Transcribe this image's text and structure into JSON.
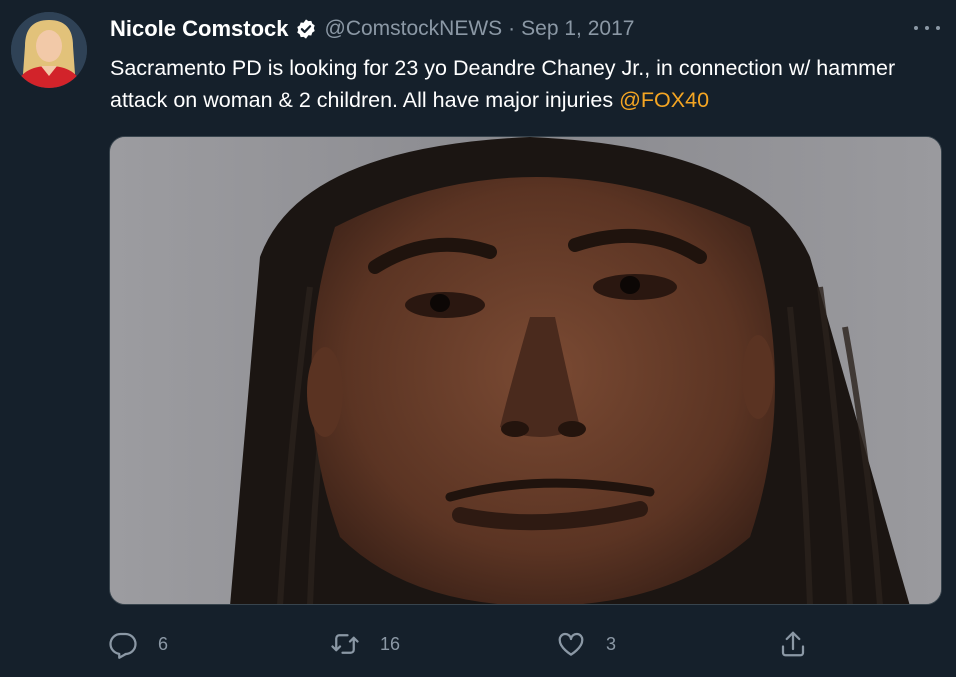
{
  "author": {
    "display_name": "Nicole Comstock",
    "handle": "@ComstockNEWS",
    "separator": "·",
    "date": "Sep 1, 2017",
    "verified": true
  },
  "tweet": {
    "text_before": "Sacramento PD is looking for 23 yo Deandre Chaney Jr., in connection w/ hammer attack on woman & 2 children. All have major injuries ",
    "mention": "@FOX40"
  },
  "media": {
    "type": "photo"
  },
  "actions": {
    "reply_count": "6",
    "retweet_count": "16",
    "like_count": "3"
  },
  "icons": {
    "verified": "verified-badge-icon",
    "more": "more-options-icon",
    "reply": "reply-icon",
    "retweet": "retweet-icon",
    "like": "heart-icon",
    "share": "share-icon"
  },
  "colors": {
    "background": "#15202b",
    "text": "#ffffff",
    "secondary_text": "#8b98a5",
    "mention": "#f4a523",
    "border": "#38444d"
  }
}
